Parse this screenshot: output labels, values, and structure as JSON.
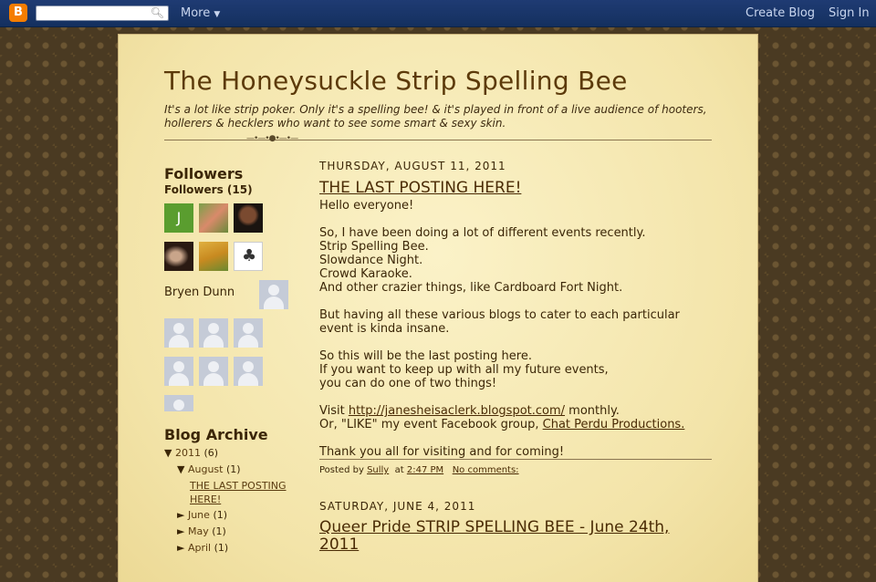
{
  "navbar": {
    "more_label": "More",
    "create_blog": "Create Blog",
    "sign_in": "Sign In",
    "search_placeholder": ""
  },
  "header": {
    "title": "The Honeysuckle Strip Spelling Bee",
    "description": "It's a lot like strip poker. Only it's a spelling bee! & it's played in front of a live audience of hooters, hollerers & hecklers who want to see some smart & sexy skin."
  },
  "sidebar": {
    "followers_heading": "Followers",
    "followers_count": "Followers (15)",
    "avatar_letter": "J",
    "broken_follower_name": "Bryen Dunn",
    "archive_heading": "Blog Archive",
    "archive": {
      "year_toggle": "▼",
      "year": "2011",
      "year_count": "(6)",
      "month_open_toggle": "▼",
      "month_open": "August",
      "month_open_count": "(1)",
      "post_link": "THE LAST POSTING HERE!",
      "months": [
        {
          "toggle": "►",
          "name": "June",
          "count": "(1)"
        },
        {
          "toggle": "►",
          "name": "May",
          "count": "(1)"
        },
        {
          "toggle": "►",
          "name": "April",
          "count": "(1)"
        }
      ]
    }
  },
  "posts": [
    {
      "date": "THURSDAY, AUGUST 11, 2011",
      "title": "THE LAST POSTING HERE!",
      "lines": {
        "greeting": "Hello everyone!",
        "p1_1": "So, I have been doing a lot of different events recently.",
        "p1_2": "Strip Spelling Bee.",
        "p1_3": "Slowdance Night.",
        "p1_4": "Crowd Karaoke.",
        "p1_5": "And other crazier things, like Cardboard Fort Night.",
        "p2": "But having all these various blogs to cater to each particular event is kinda insane.",
        "p3_1": "So this will be the last posting here.",
        "p3_2": "If you want to keep up with all my future events,",
        "p3_3": "you can do one of two things!",
        "visit_prefix": "Visit ",
        "visit_link": "http://janesheisaclerk.blogspot.com/",
        "visit_suffix": " monthly.",
        "like_prefix": "Or, \"LIKE\" my event Facebook group, ",
        "like_link": "Chat Perdu Productions.",
        "thanks": "Thank you all for visiting and for coming!"
      },
      "footer": {
        "posted_by": "Posted by",
        "author": "Sully",
        "at": "at",
        "time": "2:47 PM",
        "comments": "No comments:"
      }
    },
    {
      "date": "SATURDAY, JUNE 4, 2011",
      "title": "Queer Pride STRIP SPELLING BEE - June 24th, 2011"
    }
  ]
}
